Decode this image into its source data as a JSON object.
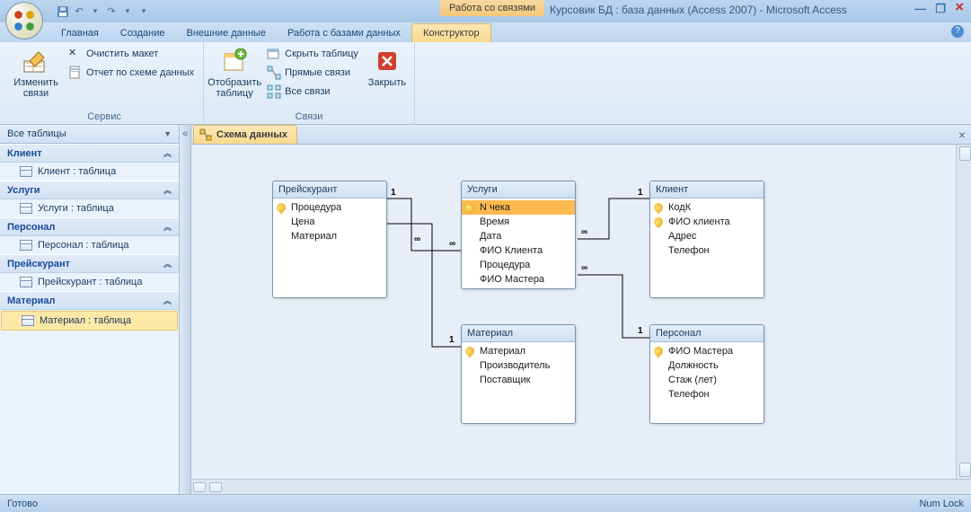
{
  "title_context": "Работа со связями",
  "title_text": "Курсовик БД : база данных (Access 2007) - Microsoft Access",
  "ribbon_tabs": {
    "t0": "Главная",
    "t1": "Создание",
    "t2": "Внешние данные",
    "t3": "Работа с базами данных",
    "t4": "Конструктор"
  },
  "ribbon": {
    "g1_label": "Сервис",
    "g2_label": "Связи",
    "edit_rel": "Изменить\nсвязи",
    "clear": "Очистить макет",
    "report": "Отчет по схеме данных",
    "show_tbl": "Отобразить\nтаблицу",
    "hide": "Скрыть таблицу",
    "direct": "Прямые связи",
    "all": "Все связи",
    "close": "Закрыть"
  },
  "nav": {
    "title": "Все таблицы",
    "g": [
      {
        "h": "Клиент",
        "it": "Клиент : таблица"
      },
      {
        "h": "Услуги",
        "it": "Услуги : таблица"
      },
      {
        "h": "Персонал",
        "it": "Персонал : таблица"
      },
      {
        "h": "Прейскурант",
        "it": "Прейскурант : таблица"
      },
      {
        "h": "Материал",
        "it": "Материал : таблица"
      }
    ]
  },
  "doc_tab": "Схема данных",
  "tables": {
    "preis": {
      "title": "Прейскурант",
      "f": [
        "Процедура",
        "Цена",
        "Материал"
      ]
    },
    "uslugi": {
      "title": "Услуги",
      "f": [
        "N чека",
        "Время",
        "Дата",
        "ФИО Клиента",
        "Процедура",
        "ФИО Мастера"
      ]
    },
    "klient": {
      "title": "Клиент",
      "f": [
        "КодК",
        "ФИО клиента",
        "Адрес",
        "Телефон"
      ]
    },
    "material": {
      "title": "Материал",
      "f": [
        "Материал",
        "Производитель",
        "Поставщик"
      ]
    },
    "personal": {
      "title": "Персонал",
      "f": [
        "ФИО Мастера",
        "Должность",
        "Стаж (лет)",
        "Телефон"
      ]
    }
  },
  "status": {
    "ready": "Готово",
    "numlock": "Num Lock"
  }
}
